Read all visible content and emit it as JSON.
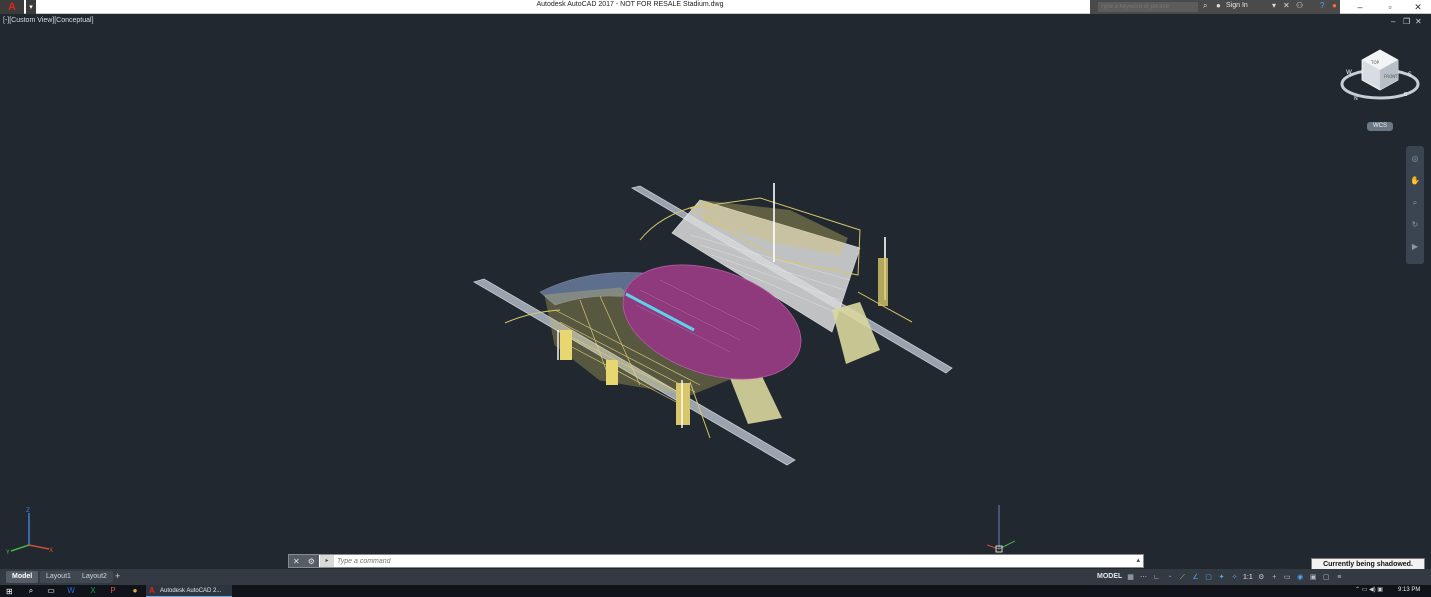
{
  "titlebar": {
    "title": "Autodesk AutoCAD 2017 - NOT FOR RESALE    Stadium.dwg",
    "search_placeholder": "Type a keyword or phrase",
    "sign_in": "Sign In",
    "app_logo": "A"
  },
  "viewport": {
    "label": "[-][Custom View][Conceptual]",
    "wcs": "WCS"
  },
  "viewcube": {
    "face_top": "TOP",
    "face_front": "FRONT",
    "compass_n": "N",
    "compass_s": "S",
    "compass_e": "E",
    "compass_w": "W"
  },
  "ucs": {
    "x": "X",
    "y": "Y",
    "z": "Z"
  },
  "command": {
    "placeholder": "Type a command"
  },
  "tooltip": "Currently being shadowed.",
  "layout_tabs": [
    {
      "label": "Model",
      "active": true
    },
    {
      "label": "Layout1",
      "active": false
    },
    {
      "label": "Layout2",
      "active": false
    }
  ],
  "status": {
    "model": "MODEL",
    "scale": "1:1"
  },
  "taskbar": {
    "active_app": "Autodesk AutoCAD 2...",
    "time": "9:13 PM"
  },
  "colors": {
    "background": "#212830",
    "field": "#8e3a7c",
    "track_line": "#5fd0e8",
    "structure_yellow": "#d8c76a",
    "structure_white": "#e6e6e6",
    "roof_blue": "#8fa9d9",
    "accent_blue": "#4ea3ff"
  },
  "icons": [
    "autocad-logo-icon",
    "search-icon",
    "user-icon",
    "help-icon",
    "minimize-icon",
    "maximize-icon",
    "close-icon"
  ]
}
